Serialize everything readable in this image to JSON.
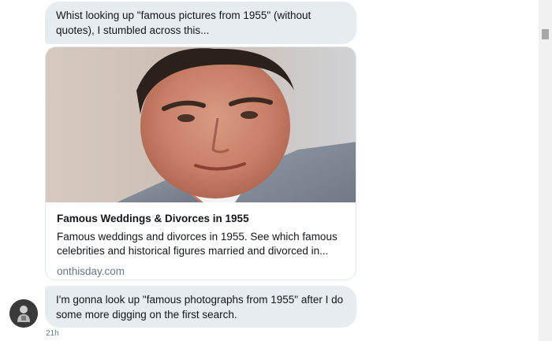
{
  "messages": {
    "first": "Whist looking up \"famous pictures from 1955\" (without quotes), I stumbled across this...",
    "second": "I'm gonna look up \"famous photographs from 1955\" after I do some more digging on the first search."
  },
  "link_card": {
    "title": "Famous Weddings & Divorces in 1955",
    "description": "Famous weddings and divorces in 1955. See which famous celebrities and historical figures married and divorced in...",
    "domain": "onthisday.com"
  },
  "timestamp": "21h"
}
